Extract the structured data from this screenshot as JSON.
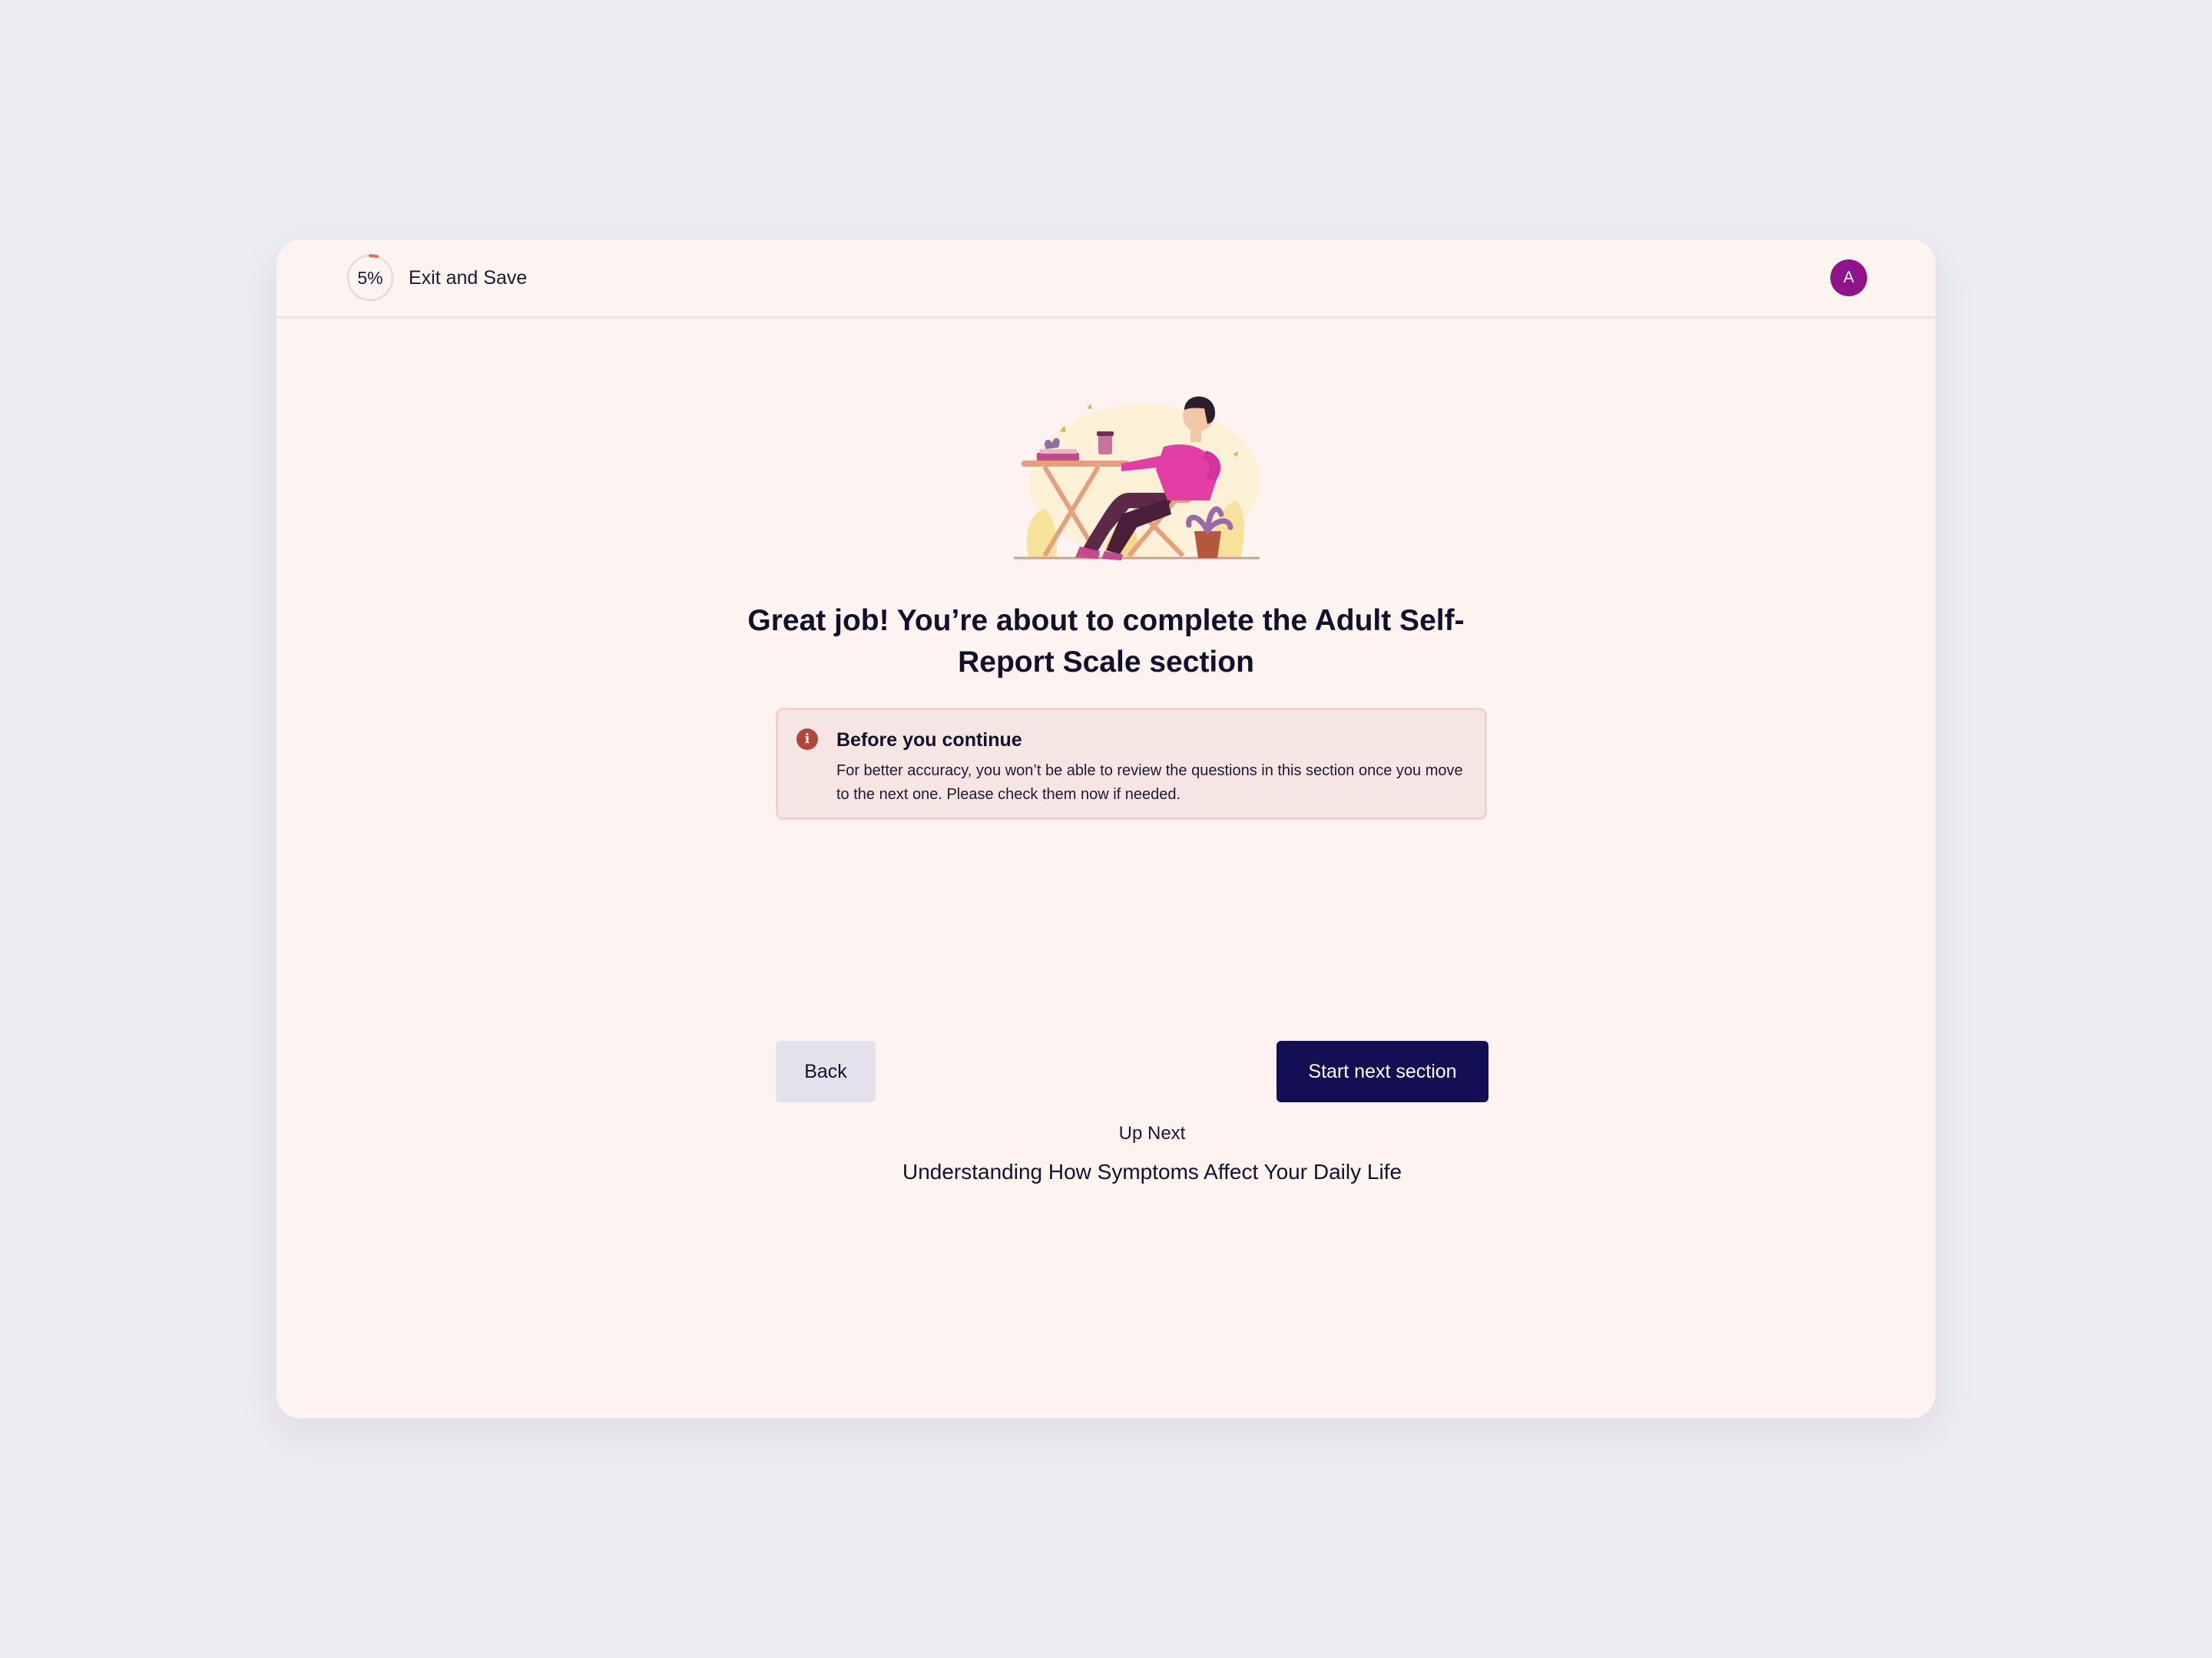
{
  "header": {
    "progress_percent": 5,
    "progress_label": "5%",
    "exit_label": "Exit and Save",
    "avatar_initial": "A"
  },
  "main": {
    "illustration_icon": "person-relaxing-illustration",
    "headline": "Great job! You’re about to complete the Adult Self-Report Scale section",
    "notice": {
      "icon": "info-icon",
      "title": "Before you continue",
      "body": "For better accuracy, you won’t be able to review the questions in this section once you move to the next one. Please check them now if needed."
    },
    "up_next": {
      "label": "Up Next",
      "title": "Understanding How Symptoms Affect Your Daily Life"
    }
  },
  "actions": {
    "back_label": "Back",
    "next_label": "Start next section"
  },
  "colors": {
    "page_background": "#edecf1",
    "card_background": "#fdf4f1",
    "primary_button": "#130f54",
    "secondary_button": "#e3e1ec",
    "avatar": "#8f148c",
    "notice_background": "#f6e6e3",
    "notice_icon": "#b2463d",
    "progress_arc": "#e5705c"
  }
}
